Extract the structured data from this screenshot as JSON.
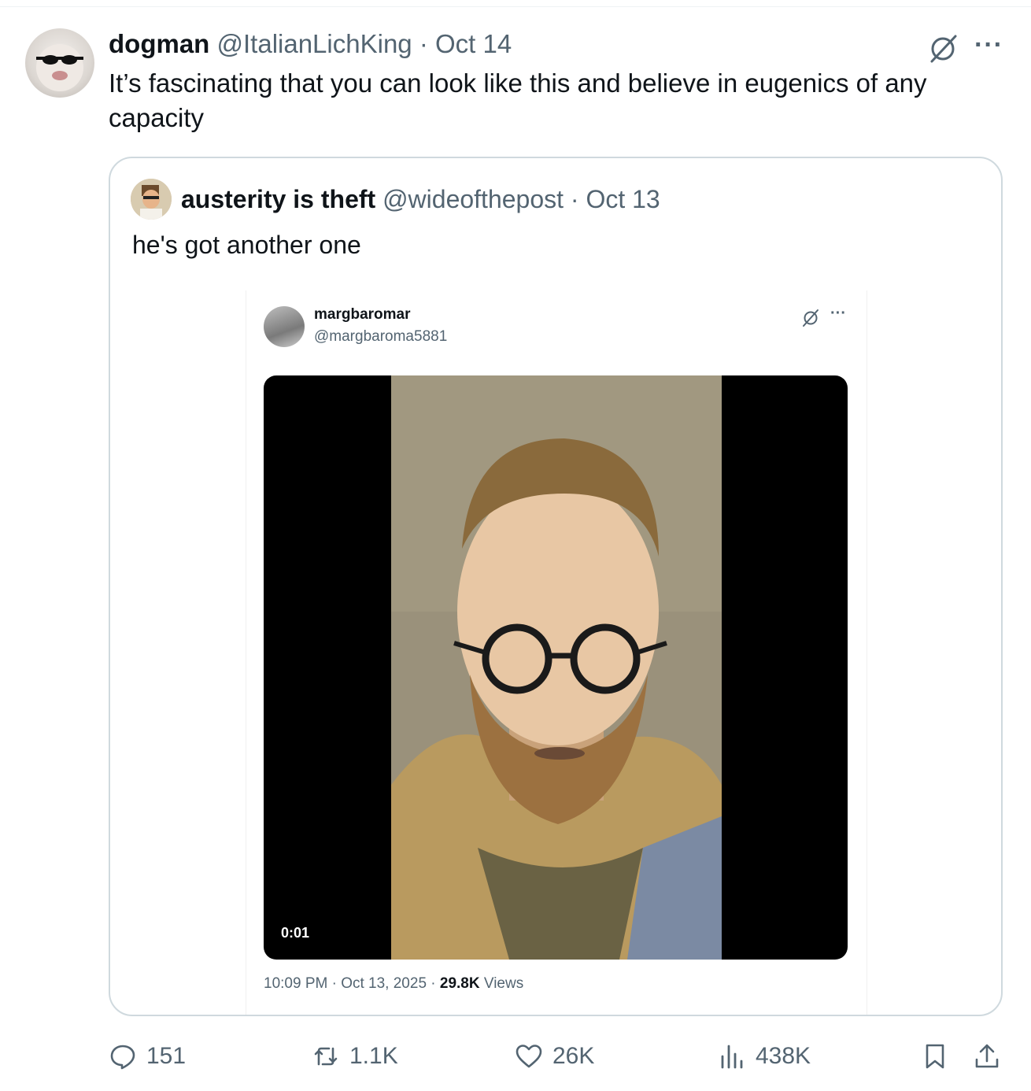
{
  "tweet": {
    "author_name": "dogman",
    "author_handle": "@ItalianLichKing",
    "separator": " · ",
    "date": "Oct 14",
    "text": "It’s fascinating that you can look like this and believe in eugenics of any capacity",
    "more_label": "···"
  },
  "quote": {
    "author_name": "austerity is theft",
    "author_handle": "@wideofthepost",
    "separator": " · ",
    "date": "Oct 13",
    "text": "he's got another one"
  },
  "embedded": {
    "author_name": "margbaromar",
    "author_handle": "@margbaroma5881",
    "more_label": "···",
    "video_duration": "0:01",
    "timestamp": "10:09 PM · Oct 13, 2025 · ",
    "views_count": "29.8K",
    "views_label": " Views"
  },
  "actions": {
    "replies": "151",
    "reposts": "1.1K",
    "likes": "26K",
    "views": "438K"
  },
  "colors": {
    "text": "#0f1419",
    "muted": "#536471",
    "border": "#cfd9de"
  },
  "icons": [
    "grok-icon",
    "more-icon",
    "reply-icon",
    "repost-icon",
    "like-icon",
    "views-icon",
    "bookmark-icon",
    "share-icon"
  ]
}
